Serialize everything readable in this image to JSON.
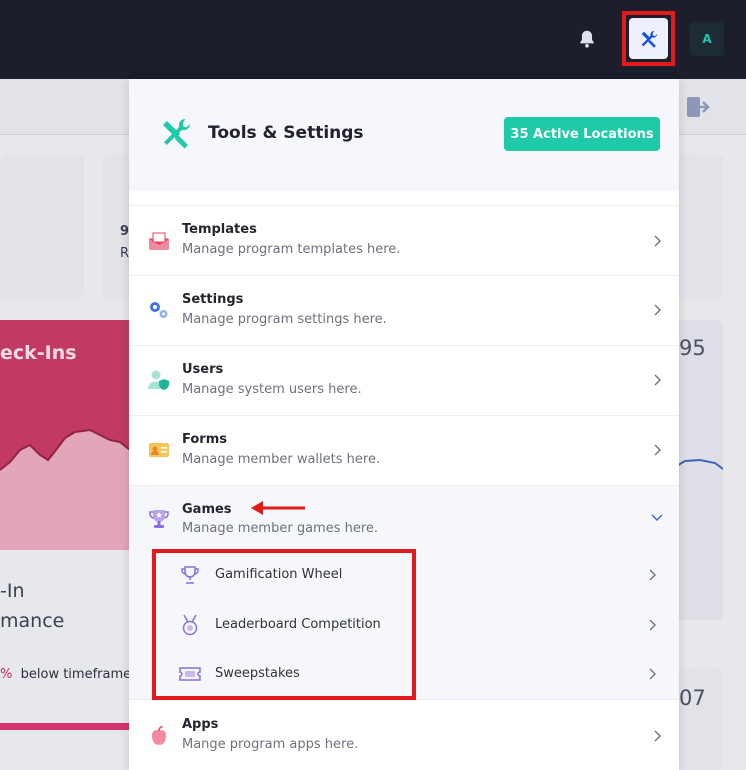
{
  "topbar": {
    "bell_icon": "bell-icon",
    "tools_icon": "tools-icon",
    "avatar_initial": "A",
    "colors": {
      "background": "#1c1e2c",
      "highlight_outline": "#e11a1a",
      "avatar_text": "#1fc9b0"
    }
  },
  "background": {
    "card_value_fragment": "9",
    "card_label_fragment": "R",
    "pink_title": "eck-Ins",
    "right_value_1": "95",
    "right_value_2": "07",
    "perf_line1": "-In",
    "perf_line2": "mance",
    "perf_pct": "%",
    "perf_text": "below timeframe"
  },
  "dropdown": {
    "title": "Tools & Settings",
    "badge": "35 Active Locations",
    "header_icon": "tools-icon",
    "items": [
      {
        "title": "Templates",
        "desc": "Manage program templates here.",
        "icon": "envelope-icon"
      },
      {
        "title": "Settings",
        "desc": "Manage program settings here.",
        "icon": "gears-icon"
      },
      {
        "title": "Users",
        "desc": "Manage system users here.",
        "icon": "user-shield-icon"
      },
      {
        "title": "Forms",
        "desc": "Manage member wallets here.",
        "icon": "id-card-icon"
      },
      {
        "title": "Games",
        "desc": "Manage member games here.",
        "icon": "trophy-star-icon",
        "expanded": true
      },
      {
        "title": "Apps",
        "desc": "Mange program apps here.",
        "icon": "apple-icon"
      }
    ],
    "games_submenu": [
      {
        "label": "Gamification Wheel",
        "icon": "trophy-icon"
      },
      {
        "label": "Leaderboard Competition",
        "icon": "medal-icon"
      },
      {
        "label": "Sweepstakes",
        "icon": "ticket-icon"
      }
    ],
    "colors": {
      "badge": "#1fcaa8",
      "accent": "#7c5cd6",
      "annotation": "#e11a1a"
    }
  }
}
